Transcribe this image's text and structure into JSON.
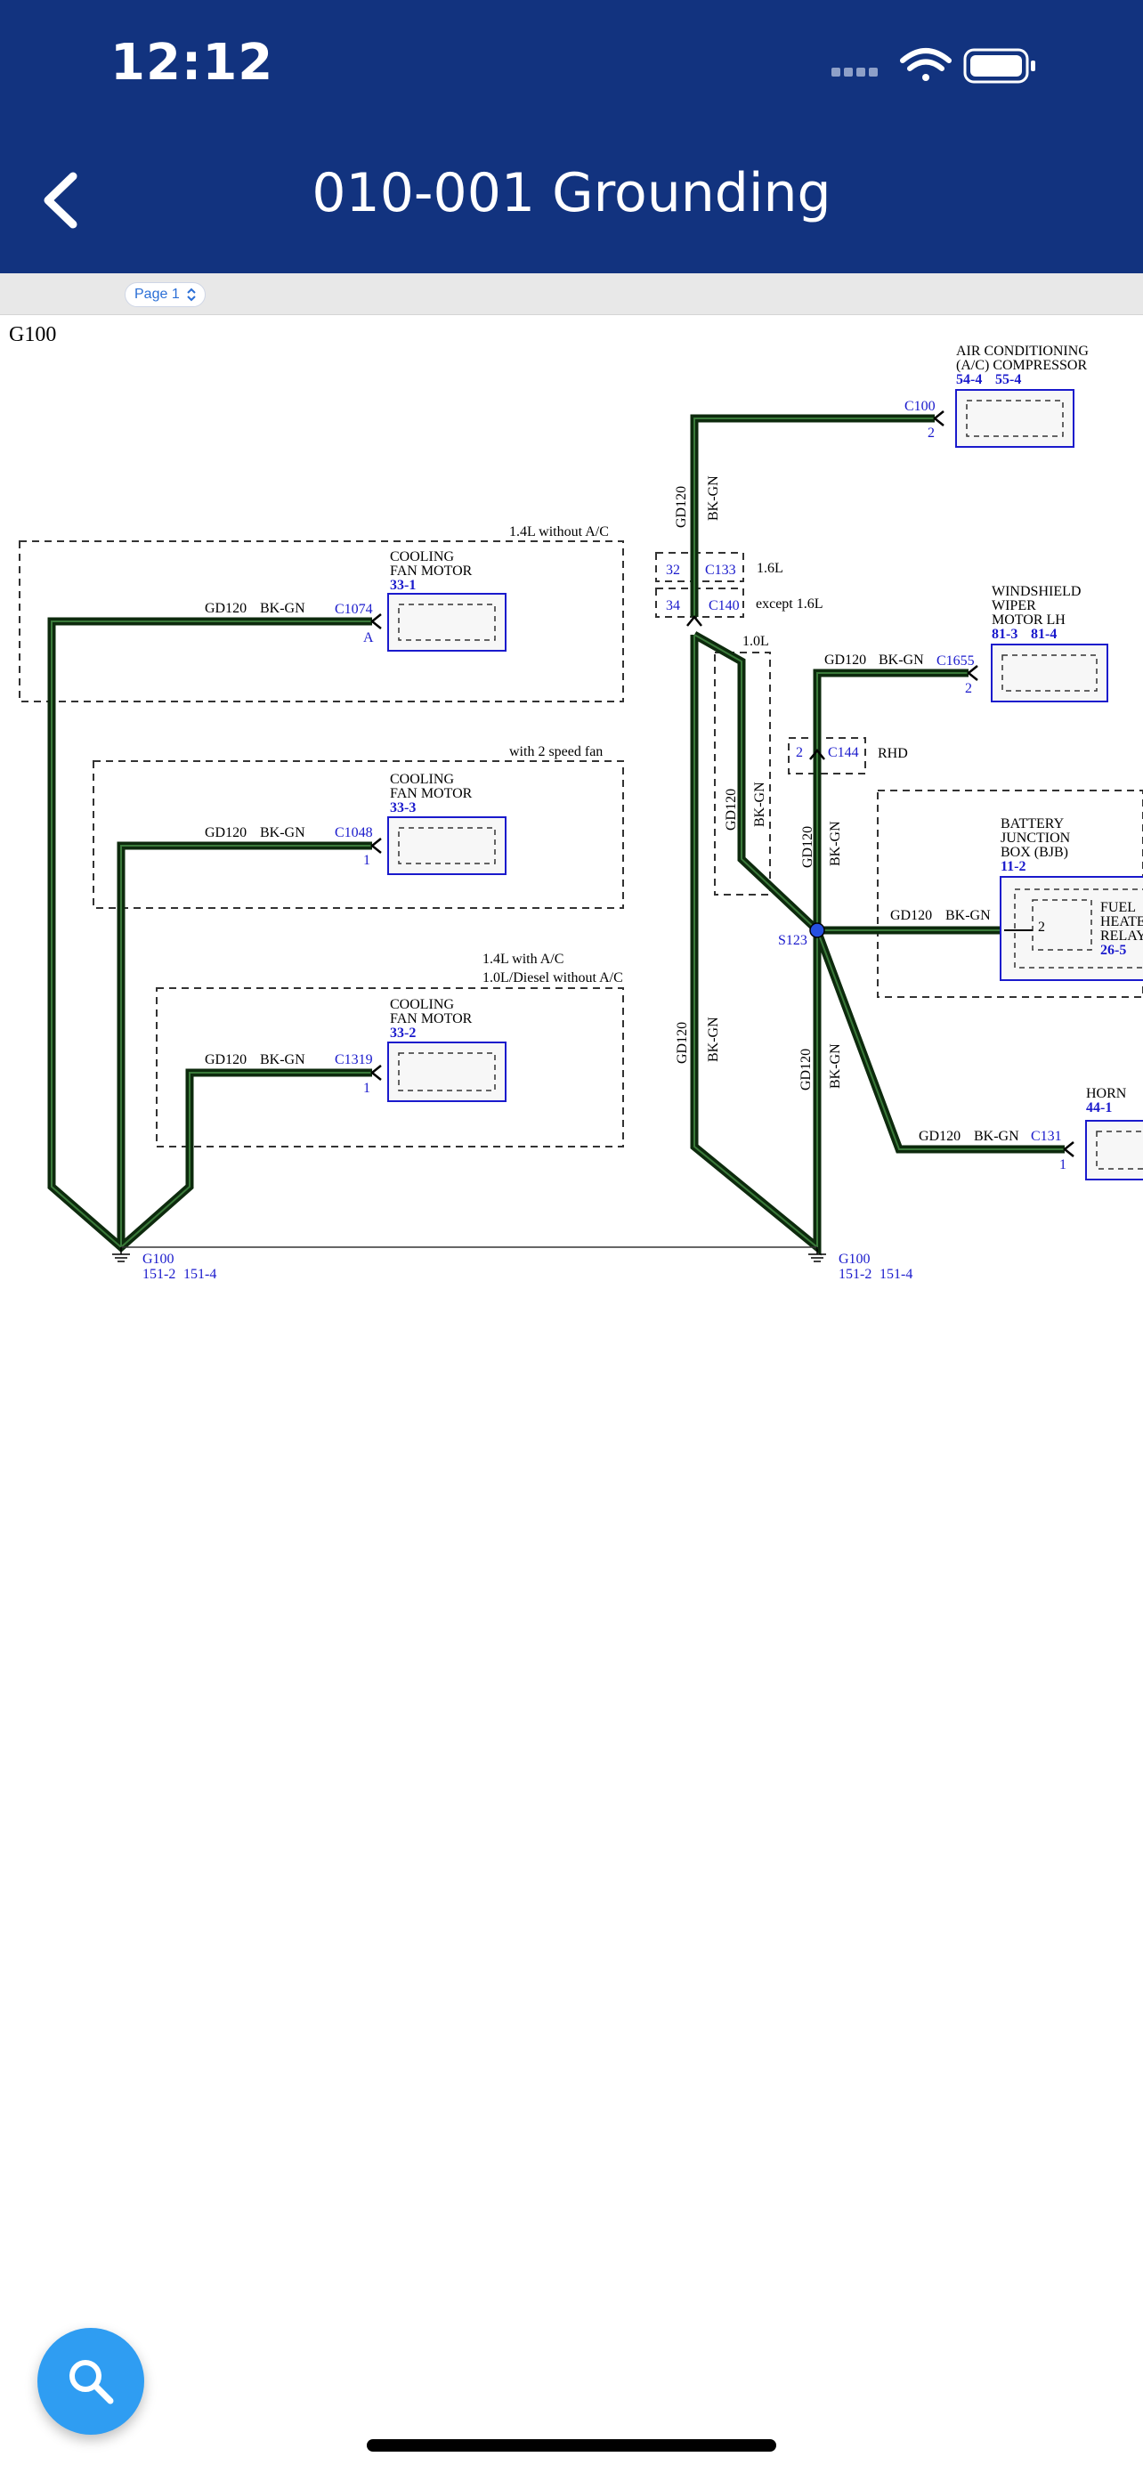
{
  "status_bar": {
    "time": "12:12"
  },
  "header": {
    "title": "010-001 Grounding",
    "back_icon": "chevron-left-icon"
  },
  "pdf_toolbar": {
    "page_label": "Page 1"
  },
  "diagram": {
    "ground_title": "G100",
    "wire": {
      "circuit": "GD120",
      "color": "BK-GN"
    },
    "conditions": {
      "no_ac": "1.4L without A/C",
      "two_speed": "with 2 speed fan",
      "with_ac": "1.4L with A/C",
      "diesel": "1.0L/Diesel without A/C",
      "l16": "1.6L",
      "except16": "except 1.6L",
      "l10": "1.0L",
      "rhd": "RHD"
    },
    "components": {
      "fan1": {
        "name1": "COOLING",
        "name2": "FAN MOTOR",
        "ref": "33-1",
        "connector": "C1074",
        "pin": "A"
      },
      "fan2": {
        "name1": "COOLING",
        "name2": "FAN MOTOR",
        "ref": "33-3",
        "connector": "C1048",
        "pin": "1"
      },
      "fan3": {
        "name1": "COOLING",
        "name2": "FAN MOTOR",
        "ref": "33-2",
        "connector": "C1319",
        "pin": "1"
      },
      "ac": {
        "name1": "AIR CONDITIONING",
        "name2": "(A/C) COMPRESSOR",
        "ref1": "54-4",
        "ref2": "55-4",
        "connector": "C100",
        "pin": "2"
      },
      "wiper": {
        "name1": "WINDSHIELD",
        "name2": "WIPER",
        "name3": "MOTOR LH",
        "ref1": "81-3",
        "ref2": "81-4",
        "connector": "C1655",
        "pin": "2"
      },
      "bjb": {
        "name1": "BATTERY",
        "name2": "JUNCTION",
        "name3": "BOX (BJB)",
        "ref": "11-2",
        "pin": "2"
      },
      "relay": {
        "name1": "FUEL",
        "name2": "HEATER",
        "name3": "RELAY",
        "ref": "26-5"
      },
      "horn": {
        "name": "HORN",
        "ref": "44-1",
        "connector": "C131",
        "pin": "1"
      }
    },
    "inline_connectors": {
      "c133": {
        "pin": "32",
        "label": "C133"
      },
      "c140": {
        "pin": "34",
        "label": "C140"
      },
      "c144": {
        "pin": "2",
        "label": "C144"
      }
    },
    "splice": "S123",
    "grounds": {
      "left": {
        "label": "G100",
        "ref1": "151-2",
        "ref2": "151-4"
      },
      "right": {
        "label": "G100",
        "ref1": "151-2",
        "ref2": "151-4"
      }
    }
  },
  "fab": {
    "icon": "search-icon"
  },
  "colors": {
    "header_bg": "#12337f",
    "fab_bg": "#2f9df2",
    "wire": "#0d2a0d",
    "link_blue": "#1a1acc"
  }
}
